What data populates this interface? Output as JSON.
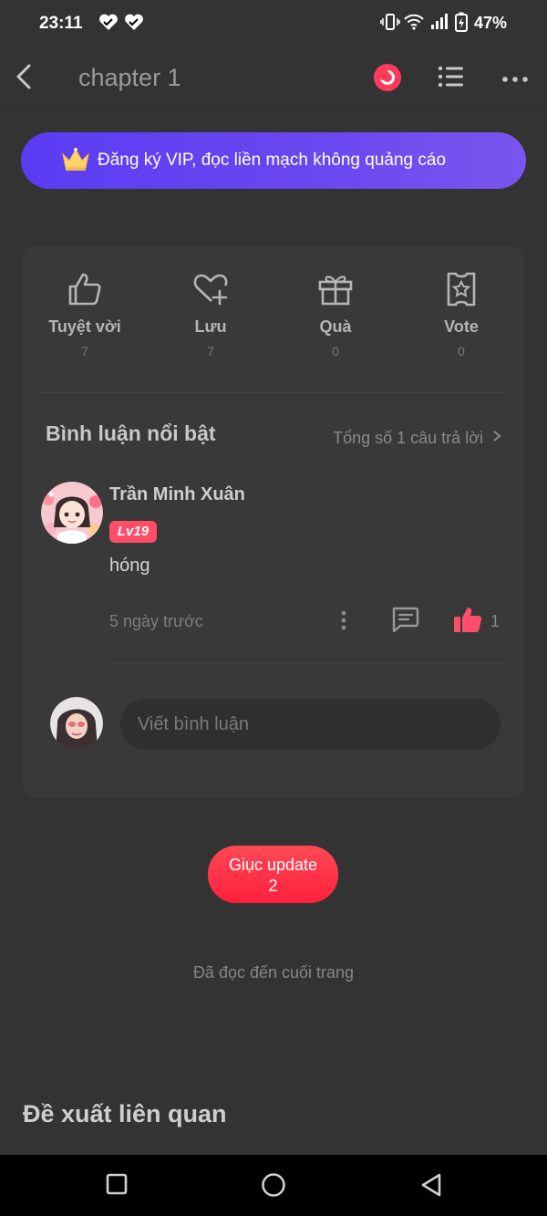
{
  "status_bar": {
    "time": "23:11",
    "battery": "47%"
  },
  "header": {
    "title": "chapter 1"
  },
  "vip_banner": {
    "text": "Đăng ký VIP, đọc liền mạch không quảng cáo"
  },
  "actions": [
    {
      "label": "Tuyệt vời",
      "count": "7",
      "icon": "thumbs-up-icon"
    },
    {
      "label": "Lưu",
      "count": "7",
      "icon": "heart-plus-icon"
    },
    {
      "label": "Quà",
      "count": "0",
      "icon": "gift-icon"
    },
    {
      "label": "Vote",
      "count": "0",
      "icon": "vote-ticket-icon"
    }
  ],
  "comments_section": {
    "title": "Bình luận nổi bật",
    "total_replies": "Tổng số 1 câu trả lời"
  },
  "comment": {
    "username": "Trần Minh Xuân",
    "level": "Lv19",
    "text": "hóng",
    "time_ago": "5 ngày trước",
    "likes": "1"
  },
  "comment_input": {
    "placeholder": "Viết bình luận"
  },
  "update_button": {
    "label": "Giục update",
    "count": "2"
  },
  "end_text": "Đã đọc đến cuối trang",
  "related_title": "Đề xuất liên quan",
  "colors": {
    "background": "#333333",
    "accent": "#ff3b5c",
    "vip": "#5b3cf3"
  }
}
